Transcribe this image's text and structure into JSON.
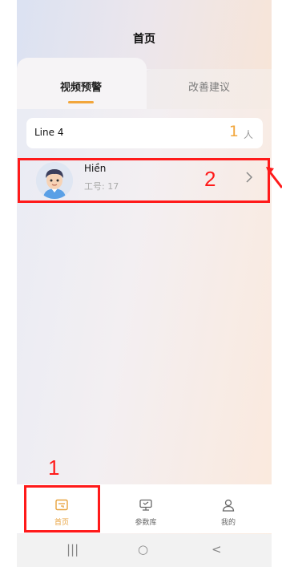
{
  "header": {
    "title": "首页"
  },
  "tabs": [
    {
      "label": "视频预警",
      "active": true
    },
    {
      "label": "改善建议",
      "active": false
    }
  ],
  "line_card": {
    "line": "Line 4",
    "count": "1",
    "unit": "人"
  },
  "employee": {
    "name": "Hiền",
    "id_text": "工号: 17"
  },
  "bottom_nav": [
    {
      "label": "首页",
      "icon": "home-icon",
      "active": true
    },
    {
      "label": "参数库",
      "icon": "database-icon",
      "active": false
    },
    {
      "label": "我的",
      "icon": "user-icon",
      "active": false
    }
  ],
  "system_nav": {
    "recents": "|||",
    "home": "○",
    "back": "<"
  },
  "annotations": {
    "one": "1",
    "two": "2"
  },
  "colors": {
    "accent": "#f2a63b",
    "annotation": "#ff1a1a"
  }
}
